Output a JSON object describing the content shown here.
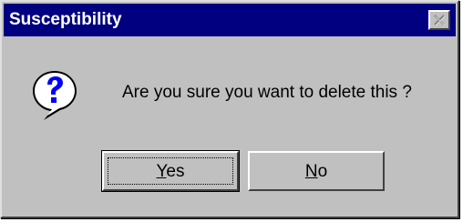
{
  "window": {
    "title": "Susceptibility",
    "close_icon": "close-icon"
  },
  "message": {
    "icon": "question-icon",
    "text": "Are you sure you want to delete this  ?"
  },
  "buttons": {
    "yes": {
      "label_mnemonic": "Y",
      "label_rest": "es"
    },
    "no": {
      "label_mnemonic": "N",
      "label_rest": "o"
    }
  },
  "colors": {
    "titlebar": "#000080",
    "face": "#c0c0c0",
    "icon_bubble": "#ffffff",
    "icon_mark": "#0000ff"
  }
}
